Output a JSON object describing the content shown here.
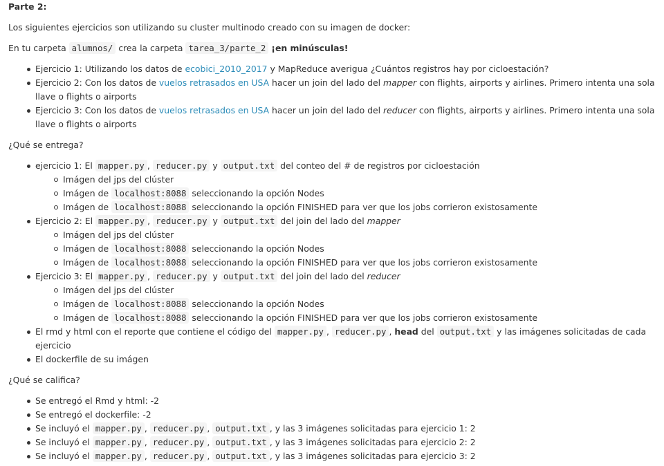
{
  "title": "Parte 2:",
  "intro": "Los siguientes ejercicios son utilizando su cluster multinodo creado con su imagen de docker:",
  "folder": {
    "pre": "En tu carpeta ",
    "code1": "alumnos/",
    "mid": " crea la carpeta ",
    "code2": "tarea_3/parte_2",
    "bold": "¡en minúsculas!"
  },
  "exercises": [
    {
      "pre": "Ejercicio 1: Utilizando los datos de ",
      "link": "ecobici_2010_2017",
      "post": " y MapReduce averigua ¿Cuántos registros hay por cicloestación?"
    },
    {
      "pre": "Ejercicio 2: Con los datos de ",
      "link": "vuelos retrasados en USA",
      "mid": " hacer un join del lado del ",
      "em": "mapper",
      "post": " con flights, airports y airlines. Primero intenta una sola llave o flights o airports"
    },
    {
      "pre": "Ejercicio 3: Con los datos de ",
      "link": "vuelos retrasados en USA",
      "mid": " hacer un join del lado del ",
      "em": "reducer",
      "post": " con flights, airports y airlines. Primero intenta una sola llave o flights o airports"
    }
  ],
  "entrega_q": "¿Qué se entrega?",
  "entrega": {
    "e1": {
      "pre": "ejercicio 1: El ",
      "c1": "mapper.py",
      "s1": ", ",
      "c2": "reducer.py",
      "s2": " y ",
      "c3": "output.txt",
      "post": " del conteo del # de registros por cicloestación"
    },
    "e2": {
      "pre": "Ejercicio 2: El ",
      "c1": "mapper.py",
      "s1": ", ",
      "c2": "reducer.py",
      "s2": " y ",
      "c3": "output.txt",
      "post": " del join del lado del ",
      "em": "mapper"
    },
    "e3": {
      "pre": "Ejercicio 3: El ",
      "c1": "mapper.py",
      "s1": ", ",
      "c2": "reducer.py",
      "s2": " y ",
      "c3": "output.txt",
      "post": " del join del lado del ",
      "em": "reducer"
    },
    "sub_jps": "Imágen del jps del clúster",
    "sub_img_pre": "Imágen de ",
    "sub_localhost": "localhost:8088",
    "sub_nodes": " seleccionando la opción Nodes",
    "sub_finished": " seleccionando la opción FINISHED para ver que los jobs corrieron existosamente",
    "rmd": {
      "pre": "El rmd y html con el reporte que contiene el código del ",
      "c1": "mapper.py",
      "s1": ", ",
      "c2": "reducer.py",
      "s2": ", ",
      "bold": "head",
      "mid": " del ",
      "c3": "output.txt",
      "post": " y las imágenes solicitadas de cada ejercicio"
    },
    "dockerfile": "El dockerfile de su imágen"
  },
  "califica_q": "¿Qué se califica?",
  "califica": {
    "rmd": "Se entregó el Rmd y html: -2",
    "docker": "Se entregó el dockerfile: -2",
    "pre": "Se incluyó el ",
    "c1": "mapper.py",
    "s1": ", ",
    "c2": "reducer.py",
    "s2": ", ",
    "c3": "output.txt",
    "post1": ", y las 3 imágenes solicitadas para ejercicio 1: 2",
    "post2": ", y las 3 imágenes solicitadas para ejercicio 2: 2",
    "post3": ", y las 3 imágenes solicitadas para ejercicio 3: 2"
  },
  "colors": {
    "link": "#2a8bb8",
    "text": "#333333",
    "code_bg": "#f4f4f4"
  }
}
